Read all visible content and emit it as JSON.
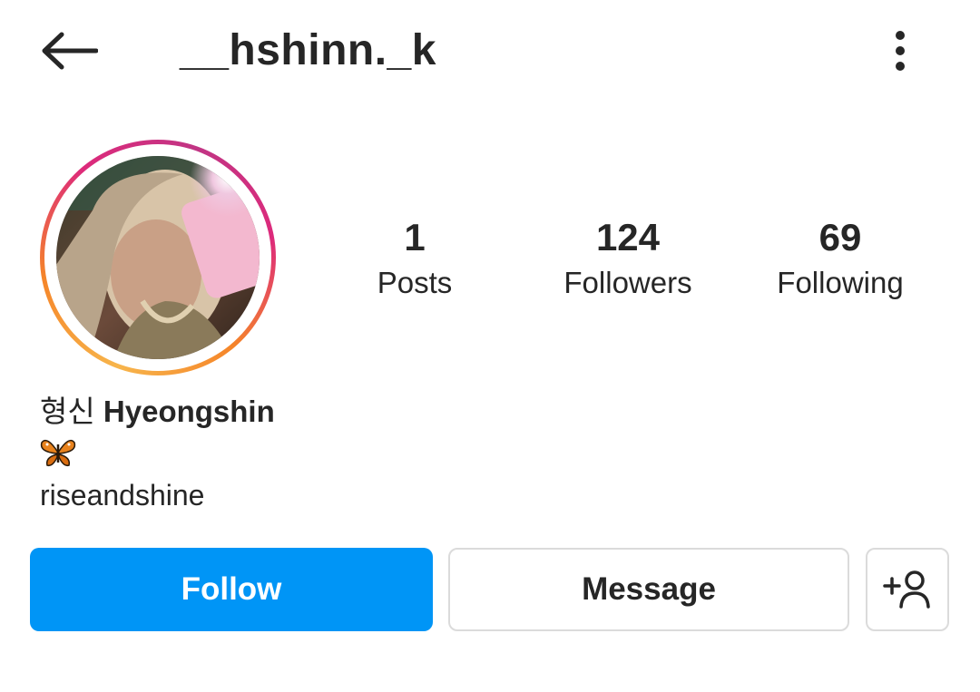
{
  "header": {
    "back_icon": "arrow-left-icon",
    "username": "__hshinn._k",
    "menu_icon": "more-vertical-icon"
  },
  "profile": {
    "avatar_ring_colors": [
      "#f7b54c",
      "#f58529",
      "#dd2a7b",
      "#c13584"
    ],
    "stats": [
      {
        "value": "1",
        "label": "Posts"
      },
      {
        "value": "124",
        "label": "Followers"
      },
      {
        "value": "69",
        "label": "Following"
      }
    ],
    "bio": {
      "name_korean": "형신",
      "name_english": "Hyeongshin",
      "emoji": "butterfly-icon",
      "text": "riseandshine"
    }
  },
  "actions": {
    "follow_label": "Follow",
    "message_label": "Message",
    "suggest_icon": "add-person-icon",
    "follow_color": "#0095f6"
  }
}
